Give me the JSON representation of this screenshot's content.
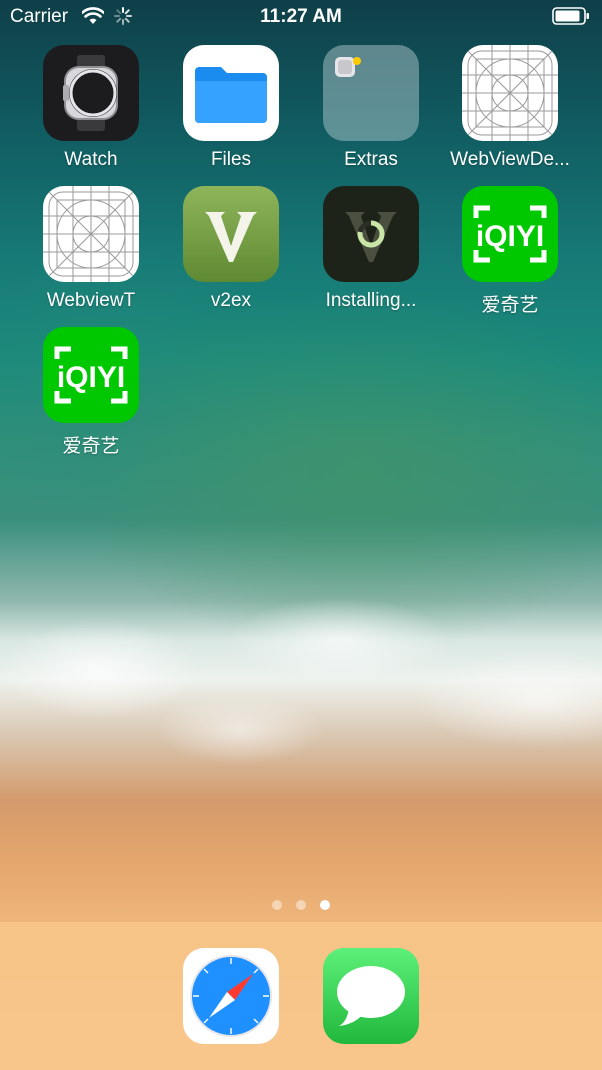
{
  "status_bar": {
    "carrier": "Carrier",
    "time": "11:27 AM"
  },
  "apps": [
    {
      "label": "Watch",
      "icon": "apple-watch-icon"
    },
    {
      "label": "Files",
      "icon": "folder-icon"
    },
    {
      "label": "Extras",
      "icon": "app-folder-icon"
    },
    {
      "label": "WebViewDe...",
      "icon": "blank-app-template-icon"
    },
    {
      "label": "WebviewT",
      "icon": "blank-app-template-icon"
    },
    {
      "label": "v2ex",
      "icon": "v2ex-logo-icon"
    },
    {
      "label": "Installing...",
      "icon": "installing-progress-icon"
    },
    {
      "label": "爱奇艺",
      "icon": "iqiyi-logo-icon"
    },
    {
      "label": "爱奇艺",
      "icon": "iqiyi-logo-icon"
    }
  ],
  "iqiyi_logo_text": "iQIYI",
  "page_indicator": {
    "count": 3,
    "current": 3
  },
  "dock": [
    {
      "label": "Safari",
      "icon": "safari-compass-icon"
    },
    {
      "label": "Messages",
      "icon": "messages-bubble-icon"
    }
  ],
  "colors": {
    "iqiyi_green": "#00c800",
    "files_blue": "#1a8cf0",
    "messages_green": "#34c759"
  }
}
